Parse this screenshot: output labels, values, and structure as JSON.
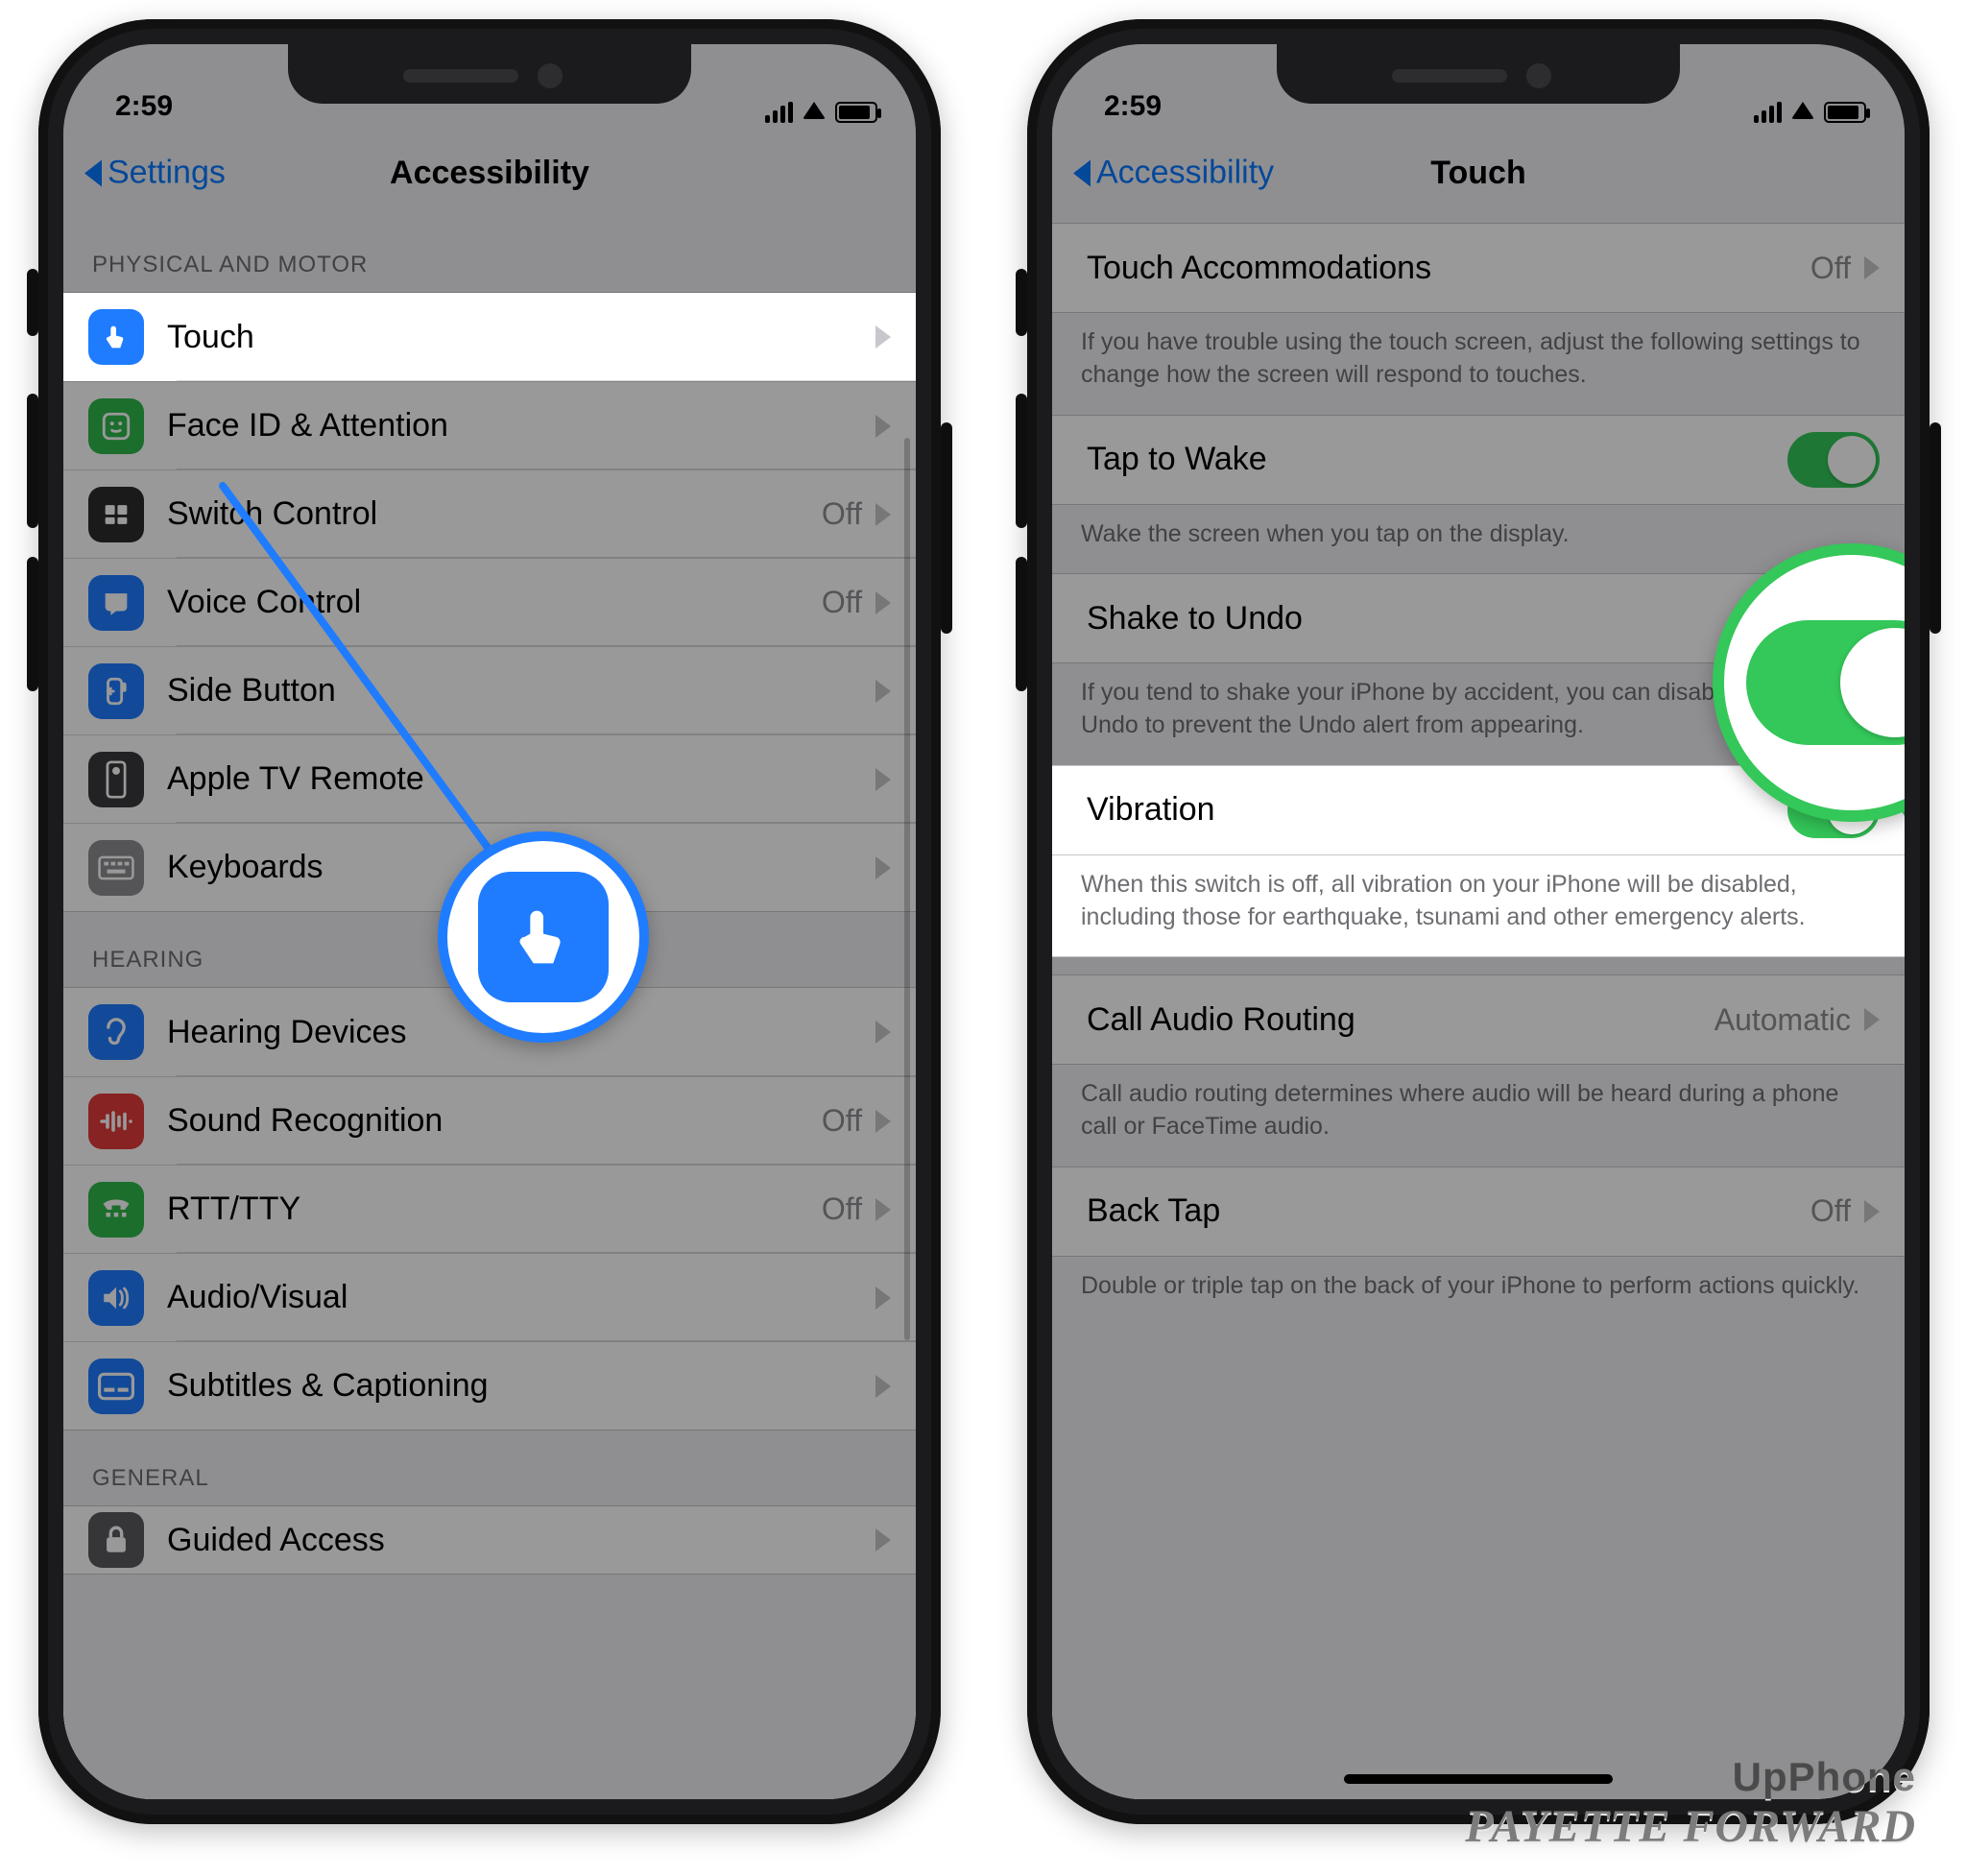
{
  "watermark": {
    "line1": "UpPhone",
    "line2": "PAYETTE FORWARD"
  },
  "left": {
    "time": "2:59",
    "nav": {
      "back": "Settings",
      "title": "Accessibility"
    },
    "sections": {
      "physical": {
        "header": "PHYSICAL AND MOTOR",
        "items": [
          {
            "label": "Touch",
            "detail": "",
            "icon": "touch"
          },
          {
            "label": "Face ID & Attention",
            "detail": "",
            "icon": "face"
          },
          {
            "label": "Switch Control",
            "detail": "Off",
            "icon": "switch"
          },
          {
            "label": "Voice Control",
            "detail": "Off",
            "icon": "voice"
          },
          {
            "label": "Side Button",
            "detail": "",
            "icon": "side"
          },
          {
            "label": "Apple TV Remote",
            "detail": "",
            "icon": "atv"
          },
          {
            "label": "Keyboards",
            "detail": "",
            "icon": "keyb"
          }
        ]
      },
      "hearing": {
        "header": "HEARING",
        "items": [
          {
            "label": "Hearing Devices",
            "detail": "",
            "icon": "hear"
          },
          {
            "label": "Sound Recognition",
            "detail": "Off",
            "icon": "sound"
          },
          {
            "label": "RTT/TTY",
            "detail": "Off",
            "icon": "rtt"
          },
          {
            "label": "Audio/Visual",
            "detail": "",
            "icon": "av"
          },
          {
            "label": "Subtitles & Captioning",
            "detail": "",
            "icon": "sub"
          }
        ]
      },
      "general": {
        "header": "GENERAL",
        "items": [
          {
            "label": "Guided Access",
            "detail": "",
            "icon": "ga"
          }
        ]
      }
    }
  },
  "right": {
    "time": "2:59",
    "nav": {
      "back": "Accessibility",
      "title": "Touch"
    },
    "rows": {
      "touchAccommodations": {
        "label": "Touch Accommodations",
        "detail": "Off"
      },
      "touchAccommodationsFooter": "If you have trouble using the touch screen, adjust the following settings to change how the screen will respond to touches.",
      "tapToWake": {
        "label": "Tap to Wake"
      },
      "tapToWakeFooter": "Wake the screen when you tap on the display.",
      "shakeToUndo": {
        "label": "Shake to Undo"
      },
      "shakeToUndoFooter": "If you tend to shake your iPhone by accident, you can disable Shake to Undo to prevent the Undo alert from appearing.",
      "vibration": {
        "label": "Vibration"
      },
      "vibrationFooter": "When this switch is off, all vibration on your iPhone will be disabled, including those for earthquake, tsunami and other emergency alerts.",
      "callAudio": {
        "label": "Call Audio Routing",
        "detail": "Automatic"
      },
      "callAudioFooter": "Call audio routing determines where audio will be heard during a phone call or FaceTime audio.",
      "backTap": {
        "label": "Back Tap",
        "detail": "Off"
      },
      "backTapFooter": "Double or triple tap on the back of your iPhone to perform actions quickly."
    }
  }
}
